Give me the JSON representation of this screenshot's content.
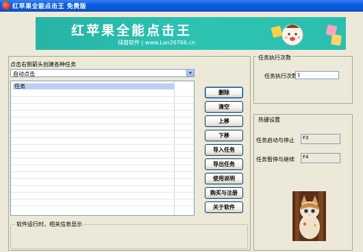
{
  "window": {
    "title": "红苹果全能点击王  免费版"
  },
  "banner": {
    "title": "红苹果全能点击王",
    "subtitle": "绿茵软件 | www.Lan26766.cn"
  },
  "task": {
    "hint": "点击右侧箭头创建各种任务",
    "combo_value": "自动点击",
    "list_header": "任务"
  },
  "buttons": {
    "delete": "删除",
    "clear": "清空",
    "move_up": "上移",
    "move_down": "下移",
    "import": "导入任务",
    "export": "导出任务",
    "help": "使用说明",
    "buy": "购买与注册",
    "about": "关于软件"
  },
  "status_group": {
    "label": "软件运行时，相关信息显示"
  },
  "exec_group": {
    "label": "任务执行次数",
    "field_label": "任务执行次数",
    "value": "1"
  },
  "hotkey_group": {
    "label": "热键设置",
    "start_stop_label": "任务启动与停止",
    "start_stop_key": "F3",
    "pause_resume_label": "任务暂停与继续",
    "pause_resume_key": "F4"
  },
  "colors": {
    "banner_teal": "#2cc3b1",
    "title_blue": "#0a5fe0",
    "list_header": "#c0cff0"
  }
}
